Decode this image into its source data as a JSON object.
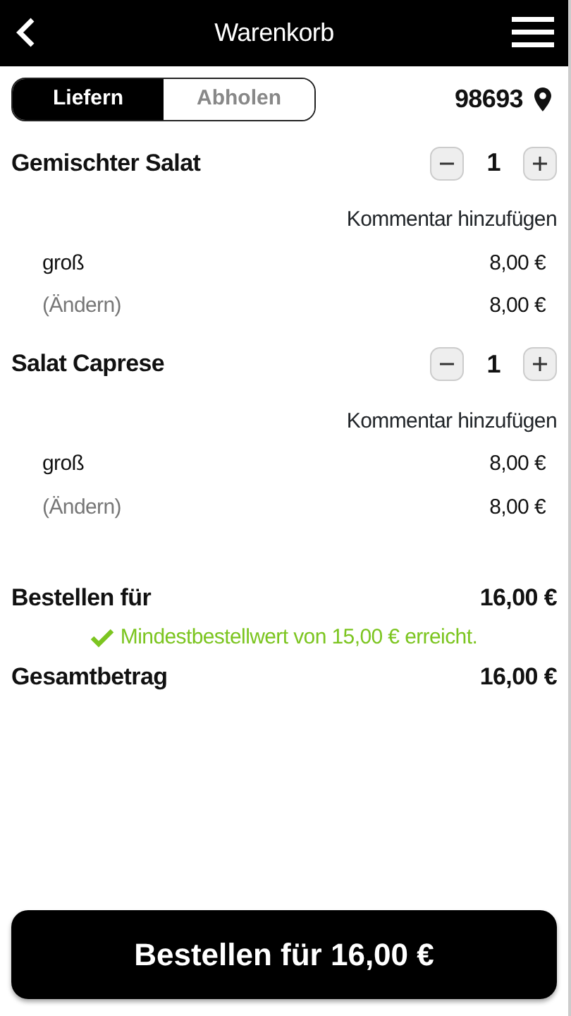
{
  "header": {
    "title": "Warenkorb"
  },
  "delivery_toggle": [
    {
      "label": "Liefern",
      "selected": true
    },
    {
      "label": "Abholen",
      "selected": false
    }
  ],
  "postal_code": "98693",
  "items": [
    {
      "name": "Gemischter Salat",
      "quantity": "1",
      "comment_link": "Kommentar hinzufügen",
      "lines": [
        {
          "kind": "option",
          "label": "groß",
          "price": "8,00 €"
        },
        {
          "kind": "change",
          "label": "(Ändern)",
          "price": "8,00 €"
        }
      ]
    },
    {
      "name": "Salat Caprese",
      "quantity": "1",
      "comment_link": "Kommentar hinzufügen",
      "lines": [
        {
          "kind": "option",
          "label": "groß",
          "price": "8,00 €"
        },
        {
          "kind": "change",
          "label": "(Ändern)",
          "price": "8,00 €"
        }
      ]
    }
  ],
  "order_for": {
    "label": "Bestellen für",
    "value": "16,00 €"
  },
  "minimum_notice": "Mindestbestellwert von 15,00 € erreicht.",
  "total": {
    "label": "Gesamtbetrag",
    "value": "16,00 €"
  },
  "order_button": "Bestellen für 16,00 €"
}
